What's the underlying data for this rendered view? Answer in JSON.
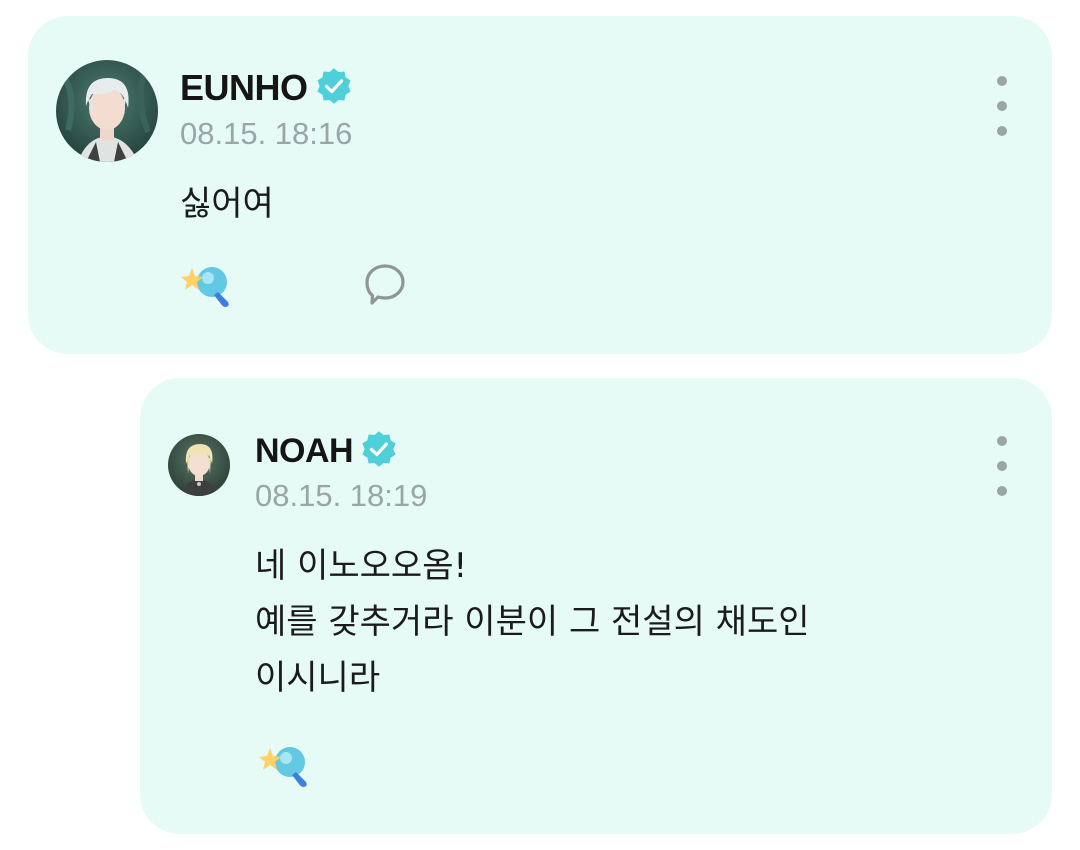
{
  "posts": [
    {
      "author": "EUNHO",
      "timestamp": "08.15. 18:16",
      "lines": [
        "싫어여"
      ],
      "verified": true,
      "avatar_icon": "eunho-avatar",
      "actions": [
        "light-stick-reaction-icon",
        "comment-icon"
      ]
    },
    {
      "author": "NOAH",
      "timestamp": "08.15. 18:19",
      "lines": [
        "네 이노오오옴!",
        "예를 갖추거라 이분이 그 전설의 채도인",
        "이시니라"
      ],
      "verified": true,
      "avatar_icon": "noah-avatar",
      "actions": [
        "light-stick-reaction-icon"
      ]
    }
  ],
  "colors": {
    "card_bg": "#e6fbf6",
    "verified_badge": "#4fd0d9",
    "timestamp": "#9aa5a6",
    "text": "#1b1b1b"
  }
}
